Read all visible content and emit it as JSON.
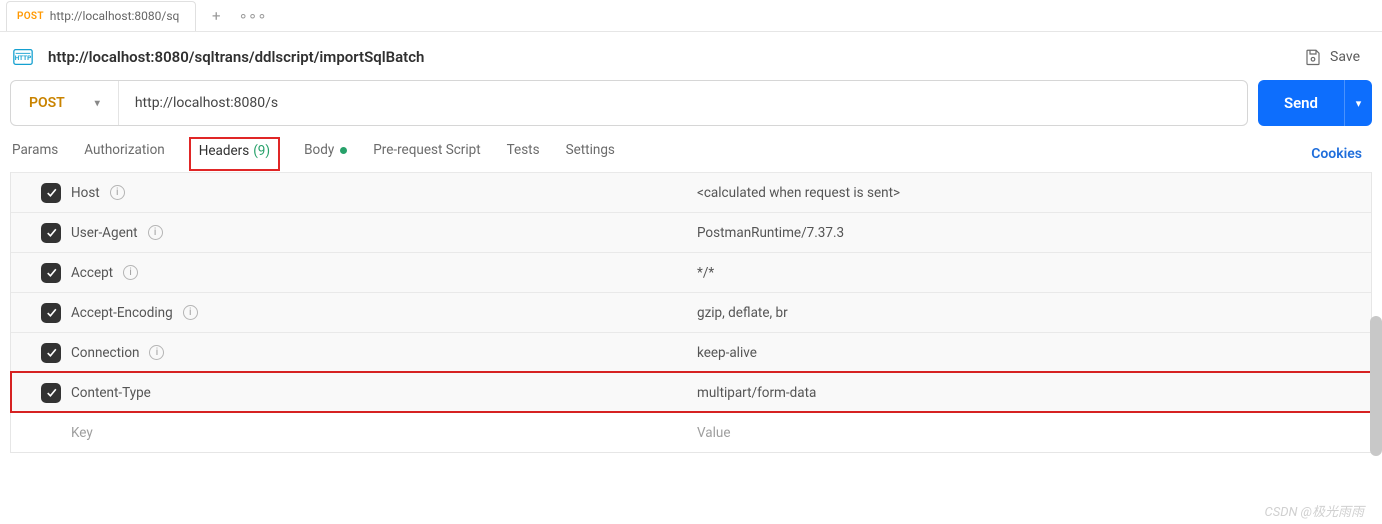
{
  "topTab": {
    "method": "POST",
    "label": "http://localhost:8080/sq"
  },
  "title": {
    "url": "http://localhost:8080/sqltrans/ddlscript/importSqlBatch"
  },
  "saveLabel": "Save",
  "request": {
    "method": "POST",
    "url": "http://localhost:8080/s",
    "sendLabel": "Send"
  },
  "tabs": {
    "params": "Params",
    "authorization": "Authorization",
    "headers": "Headers",
    "headers_count": "(9)",
    "body": "Body",
    "prerequest": "Pre-request Script",
    "tests": "Tests",
    "settings": "Settings",
    "cookies": "Cookies"
  },
  "headers": [
    {
      "checked": true,
      "info": true,
      "key": "Host",
      "value": "<calculated when request is sent>"
    },
    {
      "checked": true,
      "info": true,
      "key": "User-Agent",
      "value": "PostmanRuntime/7.37.3"
    },
    {
      "checked": true,
      "info": true,
      "key": "Accept",
      "value": "*/*"
    },
    {
      "checked": true,
      "info": true,
      "key": "Accept-Encoding",
      "value": "gzip, deflate, br"
    },
    {
      "checked": true,
      "info": true,
      "key": "Connection",
      "value": "keep-alive"
    },
    {
      "checked": true,
      "info": false,
      "key": "Content-Type",
      "value": "multipart/form-data",
      "highlight": true
    }
  ],
  "placeholder": {
    "key": "Key",
    "value": "Value"
  },
  "watermark": "CSDN @极光雨雨"
}
